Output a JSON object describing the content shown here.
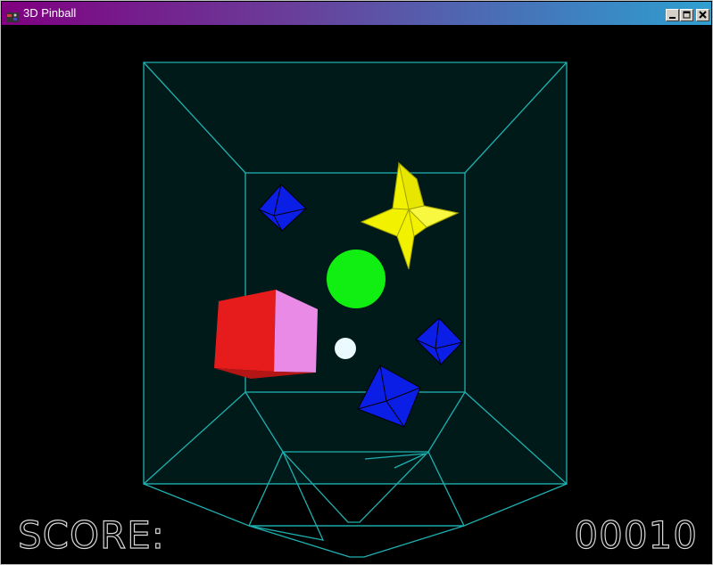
{
  "window": {
    "title": "3D Pinball",
    "controls": {
      "minimize": "minimize",
      "maximize": "maximize",
      "close": "close"
    }
  },
  "hud": {
    "score_label": "SCORE:",
    "score_value": "00010"
  },
  "colors": {
    "wireframe": "#1fb0b0",
    "playfield": "#001a1a",
    "red_cube_front": "#e61c1c",
    "red_cube_side": "#e88ae6",
    "yellow_star": "#f2f200",
    "blue_octahedron": "#0a1ee6",
    "green_sphere": "#11ee11",
    "ball": "#eafaff",
    "hud_text": "#d8d8d8"
  },
  "icons": [
    "app-icon",
    "minimize-icon",
    "maximize-icon",
    "close-icon"
  ]
}
